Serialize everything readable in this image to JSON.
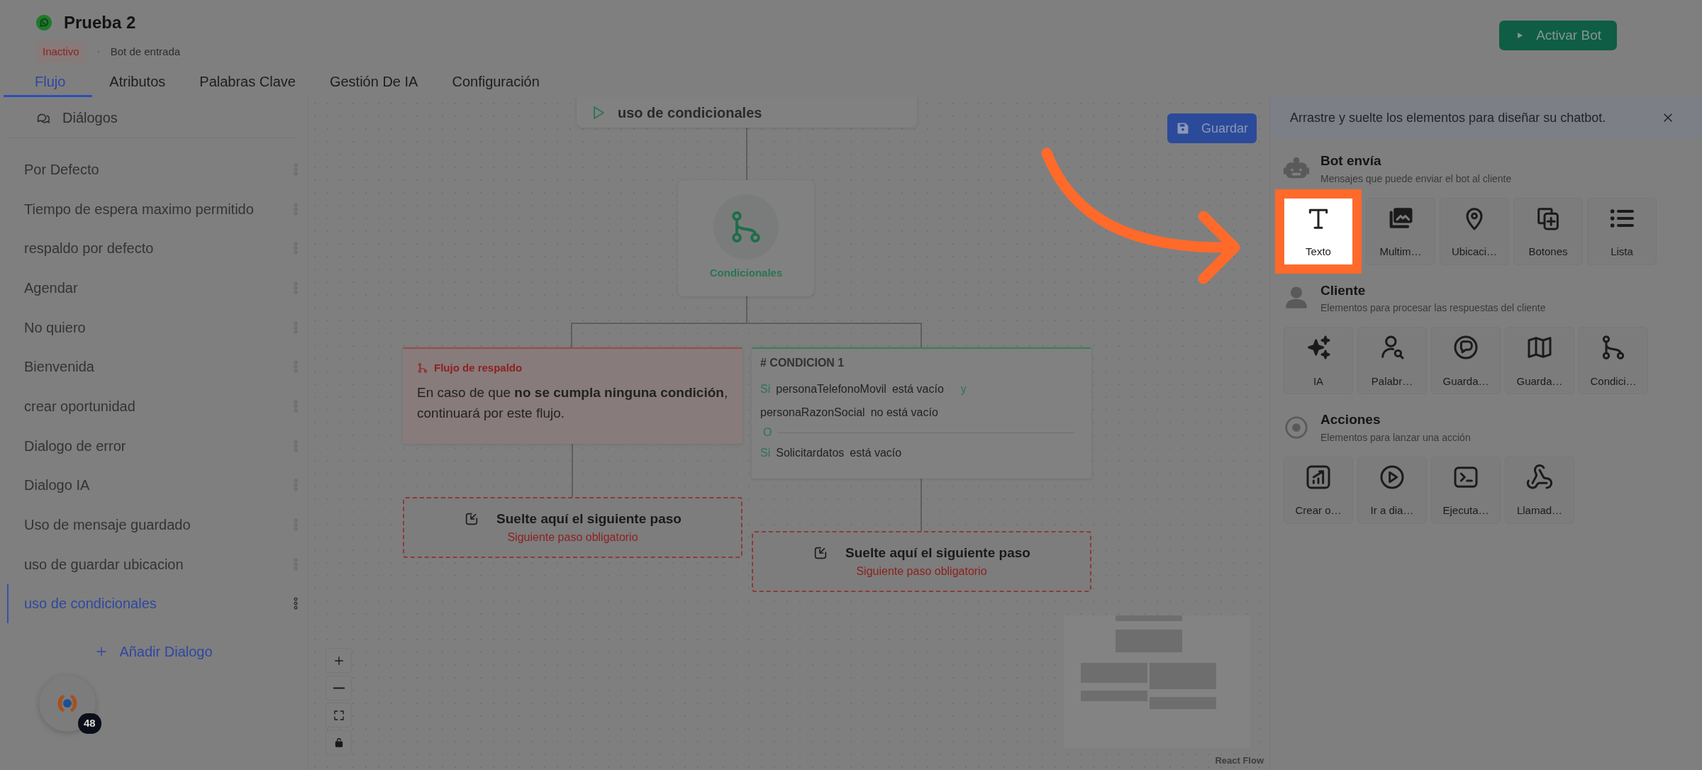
{
  "header": {
    "title": "Prueba 2",
    "status": "Inactivo",
    "type": "Bot de entrada",
    "action": "Activar Bot"
  },
  "tabs": [
    {
      "label": "Flujo",
      "selected": true
    },
    {
      "label": "Atributos",
      "selected": false
    },
    {
      "label": "Palabras Clave",
      "selected": false
    },
    {
      "label": "Gestión De IA",
      "selected": false
    },
    {
      "label": "Configuración",
      "selected": false
    }
  ],
  "sidebar": {
    "title": "Diálogos",
    "items": [
      {
        "label": "Por Defecto",
        "selected": false
      },
      {
        "label": "Tiempo de espera maximo permitido",
        "selected": false
      },
      {
        "label": "respaldo por defecto",
        "selected": false
      },
      {
        "label": "Agendar",
        "selected": false
      },
      {
        "label": "No quiero",
        "selected": false
      },
      {
        "label": "Bienvenida",
        "selected": false
      },
      {
        "label": "crear oportunidad",
        "selected": false
      },
      {
        "label": "Dialogo de error",
        "selected": false
      },
      {
        "label": "Dialogo IA",
        "selected": false
      },
      {
        "label": "Uso de mensaje guardado",
        "selected": false
      },
      {
        "label": "uso de guardar ubicacion",
        "selected": false
      },
      {
        "label": "uso de condicionales",
        "selected": true
      }
    ],
    "add": "Añadir Dialogo",
    "help_badge": "48"
  },
  "canvas": {
    "save": "Guardar",
    "start_node": "uso de condicionales",
    "conditional_node": "Condicionales",
    "fallback": {
      "title": "Flujo de respaldo",
      "text": "En caso de que **no se cumpla ninguna condición**, continuará por este flujo."
    },
    "condition": {
      "title": "# CONDICION 1",
      "rows": [
        {
          "kind": "rule",
          "prefix": "Si",
          "attribute": "personaTelefonoMovil",
          "operator": "está vacío",
          "joiner": "y"
        },
        {
          "kind": "rule",
          "attribute": "personaRazonSocial",
          "operator": "no está vacío"
        },
        {
          "kind": "or",
          "label": "O"
        },
        {
          "kind": "rule",
          "prefix": "Si",
          "attribute": "Solicitardatos",
          "operator": "está vacío"
        }
      ]
    },
    "drop_zones": [
      {
        "title": "Suelte aquí el siguiente paso",
        "note": "Siguiente paso obligatorio"
      },
      {
        "title": "Suelte aquí el siguiente paso",
        "note": "Siguiente paso obligatorio"
      }
    ],
    "attribution": "React Flow"
  },
  "palette": {
    "hint": "Arrastre y suelte los elementos para diseñar su chatbot.",
    "sections": [
      {
        "kind": "bot",
        "title": "Bot envía",
        "subtitle": "Mensajes que puede enviar el bot al cliente",
        "items": [
          {
            "kind": "text",
            "label": "Texto",
            "highlighted": true
          },
          {
            "kind": "images",
            "label": "Multim…",
            "highlighted": false
          },
          {
            "kind": "pin",
            "label": "Ubicaci…",
            "highlighted": false
          },
          {
            "kind": "buttons",
            "label": "Botones",
            "highlighted": false
          },
          {
            "kind": "list",
            "label": "Lista",
            "highlighted": false
          }
        ]
      },
      {
        "kind": "client",
        "title": "Cliente",
        "subtitle": "Elementos para procesar las respuestas del cliente",
        "items": [
          {
            "kind": "sparkles",
            "label": "IA",
            "highlighted": false
          },
          {
            "kind": "usersearch",
            "label": "Palabr…",
            "highlighted": false
          },
          {
            "kind": "chat",
            "label": "Guarda…",
            "highlighted": false
          },
          {
            "kind": "map",
            "label": "Guarda…",
            "highlighted": false
          },
          {
            "kind": "branch",
            "label": "Condici…",
            "highlighted": false
          }
        ]
      },
      {
        "kind": "actions",
        "title": "Acciones",
        "subtitle": "Elementos para lanzar una acción",
        "items": [
          {
            "kind": "chart",
            "label": "Crear o…",
            "highlighted": false
          },
          {
            "kind": "play",
            "label": "Ir a dia…",
            "highlighted": false
          },
          {
            "kind": "terminal",
            "label": "Ejecuta…",
            "highlighted": false
          },
          {
            "kind": "webhook",
            "label": "Llamad…",
            "highlighted": false
          }
        ]
      }
    ]
  }
}
